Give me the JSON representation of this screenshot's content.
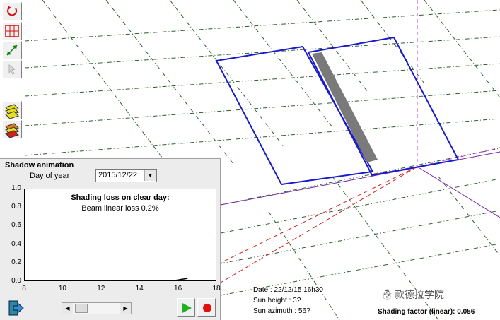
{
  "toolbar": {
    "tools": [
      "rotate-icon",
      "grid-icon",
      "resize-arrow-icon",
      "select-icon",
      "layers-icon",
      "layers-shade-icon"
    ]
  },
  "panel": {
    "title": "Shadow animation",
    "day_label": "Day of year",
    "date_value": "2015/12/22",
    "plot_title": "Shading loss on clear day:",
    "plot_subtitle": "Beam linear loss 0.2%",
    "y_ticks": [
      "1.0",
      "0.8",
      "0.6",
      "0.4",
      "0.2",
      "0.0"
    ],
    "x_ticks": [
      "8",
      "10",
      "12",
      "14",
      "16",
      "18"
    ]
  },
  "chart_data": {
    "type": "line",
    "x": [
      15.3,
      15.6,
      15.9,
      16.2,
      16.5
    ],
    "y": [
      0.0,
      0.005,
      0.01,
      0.02,
      0.03
    ],
    "xlim": [
      8,
      18
    ],
    "ylim": [
      0.0,
      1.0
    ],
    "title": "Shading loss on clear day:",
    "subtitle": "Beam linear loss 0.2%"
  },
  "status": {
    "date": "Date :  22/12/15 16h30",
    "sun_height": "Sun height : 3?",
    "sun_azimuth": "Sun azimuth : 56?",
    "shading_factor": "Shading factor (linear):  0.056"
  },
  "watermark": "☃ 款德拉学院",
  "colors": {
    "panel_outline": "#1a1acc",
    "shade": "#7a7a7a",
    "grid": "#2e5e2e",
    "sun_ray": "#cc2222",
    "axis": "#7a22aa"
  }
}
